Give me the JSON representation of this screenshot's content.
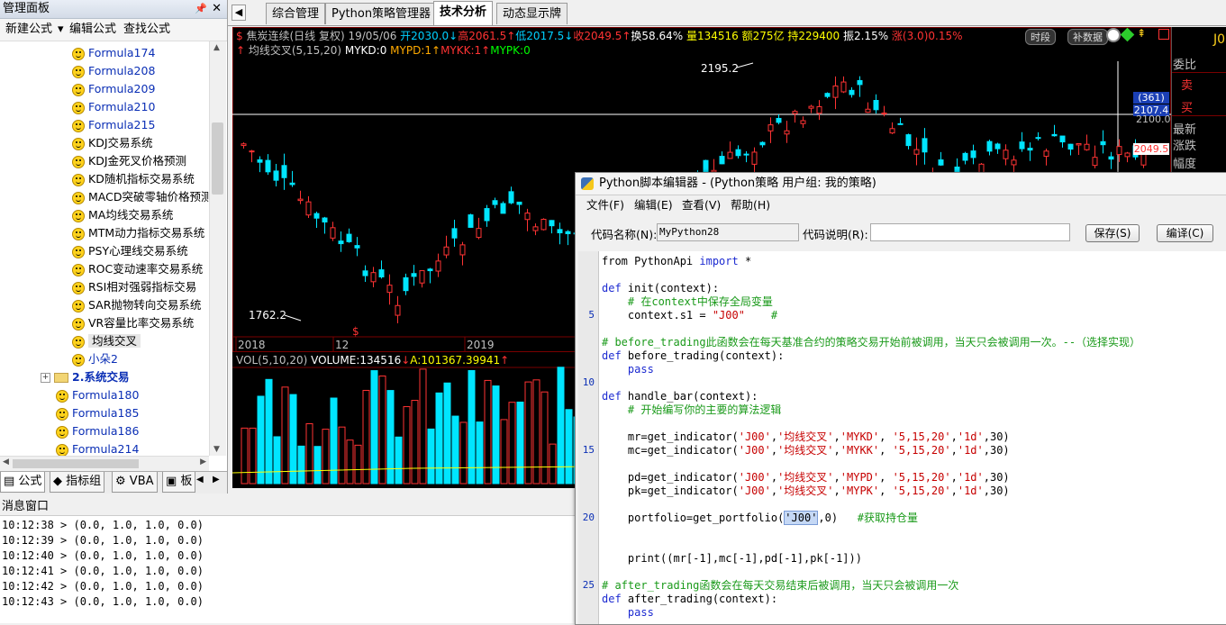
{
  "left_panel": {
    "title": "管理面板",
    "pin_icon": "📌",
    "close_icon": "✕",
    "toolbar": {
      "new_formula": "新建公式",
      "dropdown_arrow": "▾",
      "edit_formula": "编辑公式",
      "find_formula": "查找公式"
    },
    "tree_items": [
      {
        "label": "Formula174",
        "color": "blue"
      },
      {
        "label": "Formula208",
        "color": "blue"
      },
      {
        "label": "Formula209",
        "color": "blue"
      },
      {
        "label": "Formula210",
        "color": "blue"
      },
      {
        "label": "Formula215",
        "color": "blue"
      },
      {
        "label": "KDJ交易系统",
        "color": "black"
      },
      {
        "label": "KDJ金死叉价格预测",
        "color": "black"
      },
      {
        "label": "KD随机指标交易系统",
        "color": "black"
      },
      {
        "label": "MACD突破零轴价格预测",
        "color": "black"
      },
      {
        "label": "MA均线交易系统",
        "color": "black"
      },
      {
        "label": "MTM动力指标交易系统",
        "color": "black"
      },
      {
        "label": "PSY心理线交易系统",
        "color": "black"
      },
      {
        "label": "ROC变动速率交易系统",
        "color": "black"
      },
      {
        "label": "RSI相对强弱指标交易",
        "color": "black"
      },
      {
        "label": "SAR抛物转向交易系统",
        "color": "black"
      },
      {
        "label": "VR容量比率交易系统",
        "color": "black"
      },
      {
        "label": "均线交叉",
        "color": "black",
        "selected": true
      },
      {
        "label": "小朵2",
        "color": "blue"
      }
    ],
    "folder_item": {
      "label": "2.系统交易",
      "expander": "+"
    },
    "tree_items_level2": [
      {
        "label": "Formula180"
      },
      {
        "label": "Formula185"
      },
      {
        "label": "Formula186"
      },
      {
        "label": "Formula214"
      }
    ],
    "bottom_tabs": [
      {
        "label": "公式",
        "icon": "▤",
        "active": true
      },
      {
        "label": "指标组",
        "icon": "◆"
      },
      {
        "label": "VBA",
        "icon": "⚙"
      },
      {
        "label": "板",
        "icon": "▣"
      }
    ],
    "tab_nav": {
      "left": "◀",
      "right": "▶"
    }
  },
  "message_window": {
    "title": "消息窗口",
    "lines": [
      "10:12:38 > (0.0, 1.0, 1.0, 0.0)",
      "10:12:39 > (0.0, 1.0, 1.0, 0.0)",
      "10:12:40 > (0.0, 1.0, 1.0, 0.0)",
      "10:12:41 > (0.0, 1.0, 1.0, 0.0)",
      "10:12:42 > (0.0, 1.0, 1.0, 0.0)",
      "10:12:43 > (0.0, 1.0, 1.0, 0.0)"
    ]
  },
  "main_tabs": {
    "nav_arrow": "◀",
    "tabs": [
      {
        "label": "综合管理"
      },
      {
        "label": "Python策略管理器"
      },
      {
        "label": "技术分析",
        "active": true
      },
      {
        "label": "动态显示牌"
      }
    ]
  },
  "chart": {
    "info_line": [
      {
        "text": "$",
        "color": "#ff3333"
      },
      {
        "text": " 焦炭连续(日线 复权) 19/05/06 ",
        "color": "#c0c0c0"
      },
      {
        "text": "开2030.0",
        "color": "#00d0ff"
      },
      {
        "text": "↓",
        "color": "#00d0ff"
      },
      {
        "text": "高2061.5",
        "color": "#ff3333"
      },
      {
        "text": "↑",
        "color": "#ff3333"
      },
      {
        "text": "低2017.5",
        "color": "#00d0ff"
      },
      {
        "text": "↓",
        "color": "#00d0ff"
      },
      {
        "text": "收2049.5",
        "color": "#ff3333"
      },
      {
        "text": "↑",
        "color": "#ff3333"
      },
      {
        "text": "换58.64% ",
        "color": "#ffffff"
      },
      {
        "text": "量134516 ",
        "color": "#ffff00"
      },
      {
        "text": "额275亿 ",
        "color": "#ffff00"
      },
      {
        "text": "持229400 ",
        "color": "#ffff00"
      },
      {
        "text": "振2.15% ",
        "color": "#ffffff"
      },
      {
        "text": "涨(3.0)0.15%",
        "color": "#ff3333"
      }
    ],
    "indicator_line": [
      {
        "text": "↑ ",
        "color": "#ff3333"
      },
      {
        "text": "均线交叉(5,15,20) ",
        "color": "#c0c0c0"
      },
      {
        "text": "MYKD:0 ",
        "color": "#ffffff"
      },
      {
        "text": "MYPD:1",
        "color": "#ffaa00"
      },
      {
        "text": "↑",
        "color": "#ffaa00"
      },
      {
        "text": "MYKK:1",
        "color": "#ff3333"
      },
      {
        "text": "↑",
        "color": "#ff3333"
      },
      {
        "text": "MYPK:0",
        "color": "#00ff00"
      }
    ],
    "buttons": {
      "time_segment": "时段",
      "supplement_data": "补数据"
    },
    "labels": {
      "high": "2195.2",
      "low": "1762.2",
      "y_2100": "2100.0",
      "cursor_value": "(361)",
      "cursor_price": "2107.4",
      "last_price": "2049.5"
    },
    "x_labels": [
      "2018",
      "12",
      "2019"
    ],
    "dollar_marker": "$",
    "volume_info": [
      {
        "text": "VOL(5,10,20) ",
        "color": "#c0c0c0"
      },
      {
        "text": "VOLUME:134516",
        "color": "#ffffff"
      },
      {
        "text": "↓",
        "color": "#ff3333"
      },
      {
        "text": "A:101367.39941",
        "color": "#ffff00"
      },
      {
        "text": "↑",
        "color": "#ff3333"
      }
    ],
    "right_panel": {
      "code": "J0",
      "labels": [
        "委比",
        "卖",
        "买",
        "最新",
        "涨跌",
        "幅度"
      ]
    },
    "colors": {
      "up": "#ff3333",
      "down": "#00e5ff",
      "bg": "#000000"
    }
  },
  "editor": {
    "title": "Python脚本编辑器 - (Python策略 用户组: 我的策略)",
    "menu": [
      "文件(F)",
      "编辑(E)",
      "查看(V)",
      "帮助(H)"
    ],
    "code_name_label": "代码名称(N):",
    "code_name_value": "MyPython28",
    "code_desc_label": "代码说明(R):",
    "code_desc_value": "",
    "save_button": "保存(S)",
    "compile_button": "编译(C)",
    "line_numbers": [
      "5",
      "10",
      "15",
      "20",
      "25"
    ],
    "code_lines": [
      [
        {
          "t": "from PythonApi ",
          "c": ""
        },
        {
          "t": "import",
          "c": "kw"
        },
        {
          "t": " *",
          "c": ""
        }
      ],
      [],
      [
        {
          "t": "def",
          "c": "kw"
        },
        {
          "t": " init(context):",
          "c": ""
        }
      ],
      [
        {
          "t": "    # 在context中保存全局变量",
          "c": "cm"
        }
      ],
      [
        {
          "t": "    context.s1 = ",
          "c": ""
        },
        {
          "t": "\"J00\"",
          "c": "st"
        },
        {
          "t": "    #",
          "c": "cm"
        }
      ],
      [],
      [
        {
          "t": "# before_trading此函数会在每天基准合约的策略交易开始前被调用，当天只会被调用一次。--（选择实现）",
          "c": "cm"
        }
      ],
      [
        {
          "t": "def",
          "c": "kw"
        },
        {
          "t": " before_trading(context):",
          "c": ""
        }
      ],
      [
        {
          "t": "    pass",
          "c": "kw"
        }
      ],
      [],
      [
        {
          "t": "def",
          "c": "kw"
        },
        {
          "t": " handle_bar(context):",
          "c": ""
        }
      ],
      [
        {
          "t": "    # 开始编写你的主要的算法逻辑",
          "c": "cm"
        }
      ],
      [],
      [
        {
          "t": "    mr=get_indicator(",
          "c": ""
        },
        {
          "t": "'J00'",
          "c": "st"
        },
        {
          "t": ",",
          "c": ""
        },
        {
          "t": "'均线交叉'",
          "c": "st"
        },
        {
          "t": ",",
          "c": ""
        },
        {
          "t": "'MYKD'",
          "c": "st"
        },
        {
          "t": ", ",
          "c": ""
        },
        {
          "t": "'5,15,20'",
          "c": "st"
        },
        {
          "t": ",",
          "c": ""
        },
        {
          "t": "'1d'",
          "c": "st"
        },
        {
          "t": ",30)",
          "c": ""
        }
      ],
      [
        {
          "t": "    mc=get_indicator(",
          "c": ""
        },
        {
          "t": "'J00'",
          "c": "st"
        },
        {
          "t": ",",
          "c": ""
        },
        {
          "t": "'均线交叉'",
          "c": "st"
        },
        {
          "t": ",",
          "c": ""
        },
        {
          "t": "'MYKK'",
          "c": "st"
        },
        {
          "t": ", ",
          "c": ""
        },
        {
          "t": "'5,15,20'",
          "c": "st"
        },
        {
          "t": ",",
          "c": ""
        },
        {
          "t": "'1d'",
          "c": "st"
        },
        {
          "t": ",30)",
          "c": ""
        }
      ],
      [],
      [
        {
          "t": "    pd=get_indicator(",
          "c": ""
        },
        {
          "t": "'J00'",
          "c": "st"
        },
        {
          "t": ",",
          "c": ""
        },
        {
          "t": "'均线交叉'",
          "c": "st"
        },
        {
          "t": ",",
          "c": ""
        },
        {
          "t": "'MYPD'",
          "c": "st"
        },
        {
          "t": ", ",
          "c": ""
        },
        {
          "t": "'5,15,20'",
          "c": "st"
        },
        {
          "t": ",",
          "c": ""
        },
        {
          "t": "'1d'",
          "c": "st"
        },
        {
          "t": ",30)",
          "c": ""
        }
      ],
      [
        {
          "t": "    pk=get_indicator(",
          "c": ""
        },
        {
          "t": "'J00'",
          "c": "st"
        },
        {
          "t": ",",
          "c": ""
        },
        {
          "t": "'均线交叉'",
          "c": "st"
        },
        {
          "t": ",",
          "c": ""
        },
        {
          "t": "'MYPK'",
          "c": "st"
        },
        {
          "t": ", ",
          "c": ""
        },
        {
          "t": "'5,15,20'",
          "c": "st"
        },
        {
          "t": ",",
          "c": ""
        },
        {
          "t": "'1d'",
          "c": "st"
        },
        {
          "t": ",30)",
          "c": ""
        }
      ],
      [],
      [
        {
          "t": "    portfolio=get_portfolio(",
          "c": ""
        },
        {
          "t": "'J00'",
          "c": "hl"
        },
        {
          "t": ",0)   ",
          "c": ""
        },
        {
          "t": "#获取持仓量",
          "c": "cm"
        }
      ],
      [],
      [],
      [
        {
          "t": "    print((mr[-1],mc[-1],pd[-1],pk[-1]))",
          "c": ""
        }
      ],
      [],
      [
        {
          "t": "# after_trading函数会在每天交易结束后被调用，当天只会被调用一次",
          "c": "cm"
        }
      ],
      [
        {
          "t": "def",
          "c": "kw"
        },
        {
          "t": " after_trading(context):",
          "c": ""
        }
      ],
      [
        {
          "t": "    pass",
          "c": "kw"
        }
      ]
    ]
  }
}
